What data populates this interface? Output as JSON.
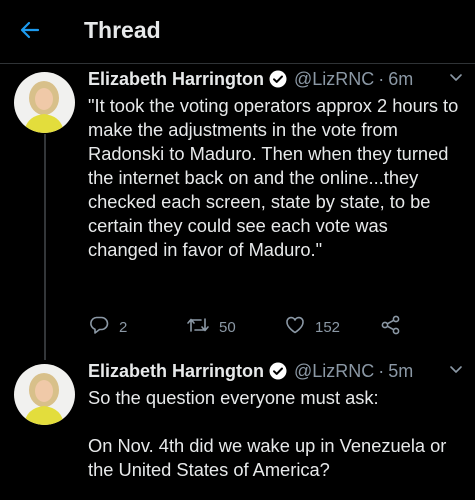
{
  "header": {
    "title": "Thread",
    "back_icon": "back-arrow-icon",
    "accent_color": "#1d9bf0"
  },
  "tweets": [
    {
      "author_name": "Elizabeth Harrington",
      "handle": "@LizRNC",
      "separator": "·",
      "time": "6m",
      "text": "\"It took the voting operators approx 2 hours to make the adjustments in the vote from Radonski to Maduro. Then when they turned the internet back on and the online...they checked each screen, state by state, to be certain they could see each vote was changed in favor of Maduro.\"",
      "replies": "2",
      "retweets": "50",
      "likes": "152"
    },
    {
      "author_name": "Elizabeth Harrington",
      "handle": "@LizRNC",
      "separator": "·",
      "time": "5m",
      "text": "So the question everyone must ask:\n\nOn Nov. 4th did we wake up in Venezuela or the United States of America?"
    }
  ]
}
